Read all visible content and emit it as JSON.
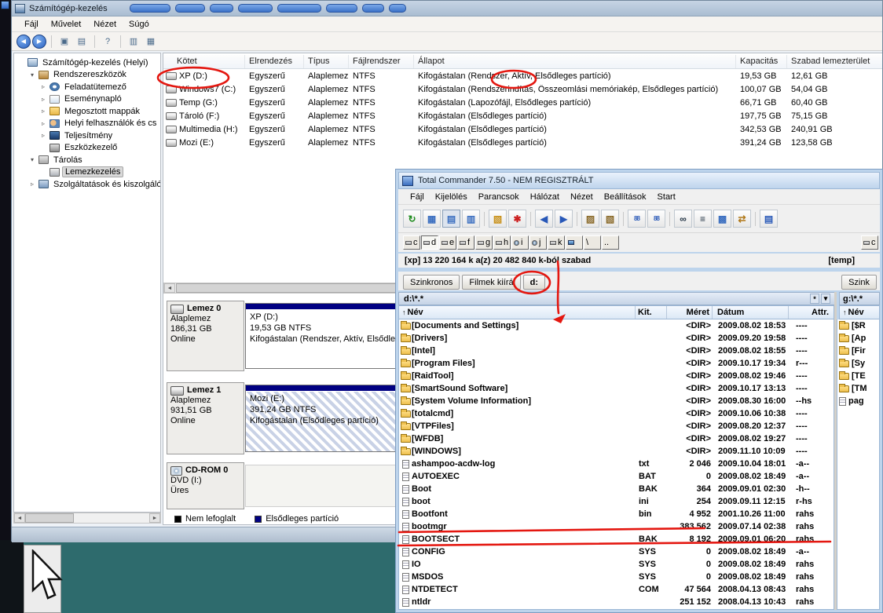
{
  "annotations": {
    "color": "#e41710"
  },
  "cm": {
    "title": "Számítógép-kezelés",
    "menu": [
      "Fájl",
      "Művelet",
      "Nézet",
      "Súgó"
    ],
    "toolbar": [
      {
        "name": "back-icon",
        "glyph": "◀",
        "circle": true
      },
      {
        "name": "forward-icon",
        "glyph": "▶",
        "circle": true
      },
      {
        "name": "sep"
      },
      {
        "name": "window-icon",
        "glyph": "▣"
      },
      {
        "name": "document-icon",
        "glyph": "▤"
      },
      {
        "name": "sep"
      },
      {
        "name": "help-icon",
        "glyph": "?"
      },
      {
        "name": "sep"
      },
      {
        "name": "console-tree-icon",
        "glyph": "▥"
      },
      {
        "name": "panes-icon",
        "glyph": "▦"
      }
    ],
    "tree": {
      "items": [
        {
          "label": "Számítógép-kezelés (Helyi)",
          "level": 0,
          "icon": "computer-icon",
          "exp": ""
        },
        {
          "label": "Rendszereszközök",
          "level": 1,
          "icon": "system-tools-icon",
          "exp": "down"
        },
        {
          "label": "Feladatütemező",
          "level": 2,
          "icon": "task-scheduler-icon",
          "exp": "right"
        },
        {
          "label": "Eseménynapló",
          "level": 2,
          "icon": "event-viewer-icon",
          "exp": "right"
        },
        {
          "label": "Megosztott mappák",
          "level": 2,
          "icon": "shared-folders-icon",
          "exp": "right"
        },
        {
          "label": "Helyi felhasználók és cs",
          "level": 2,
          "icon": "local-users-icon",
          "exp": "right"
        },
        {
          "label": "Teljesítmény",
          "level": 2,
          "icon": "performance-icon",
          "exp": "right"
        },
        {
          "label": "Eszközkezelő",
          "level": 2,
          "icon": "device-manager-icon",
          "exp": ""
        },
        {
          "label": "Tárolás",
          "level": 1,
          "icon": "storage-icon",
          "exp": "down"
        },
        {
          "label": "Lemezkezelés",
          "level": 2,
          "icon": "disk-management-icon",
          "exp": "",
          "selected": true
        },
        {
          "label": "Szolgáltatások és kiszolgáló",
          "level": 1,
          "icon": "services-icon",
          "exp": "right"
        }
      ]
    },
    "volumes": {
      "columns": [
        "Kötet",
        "Elrendezés",
        "Típus",
        "Fájlrendszer",
        "Állapot",
        "Kapacitás",
        "Szabad lemezterület"
      ],
      "rows": [
        {
          "name": "XP (D:)",
          "layout": "Egyszerű",
          "type": "Alaplemez",
          "fs": "NTFS",
          "status": "Kifogástalan (Rendszer, Aktív, Elsődleges partíció)",
          "capacity": "19,53 GB",
          "free": "12,61 GB"
        },
        {
          "name": "Windows7 (C:)",
          "layout": "Egyszerű",
          "type": "Alaplemez",
          "fs": "NTFS",
          "status": "Kifogástalan (Rendszerindítás, Összeomlási memóriakép, Elsődleges partíció)",
          "capacity": "100,07 GB",
          "free": "54,04 GB"
        },
        {
          "name": "Temp (G:)",
          "layout": "Egyszerű",
          "type": "Alaplemez",
          "fs": "NTFS",
          "status": "Kifogástalan (Lapozófájl, Elsődleges partíció)",
          "capacity": "66,71 GB",
          "free": "60,40 GB"
        },
        {
          "name": "Tároló (F:)",
          "layout": "Egyszerű",
          "type": "Alaplemez",
          "fs": "NTFS",
          "status": "Kifogástalan (Elsődleges partíció)",
          "capacity": "197,75 GB",
          "free": "75,15 GB"
        },
        {
          "name": "Multimedia (H:)",
          "layout": "Egyszerű",
          "type": "Alaplemez",
          "fs": "NTFS",
          "status": "Kifogástalan (Elsődleges partíció)",
          "capacity": "342,53 GB",
          "free": "240,91 GB"
        },
        {
          "name": "Mozi (E:)",
          "layout": "Egyszerű",
          "type": "Alaplemez",
          "fs": "NTFS",
          "status": "Kifogástalan (Elsődleges partíció)",
          "capacity": "391,24 GB",
          "free": "123,58 GB"
        }
      ]
    },
    "disks": [
      {
        "name": "Lemez 0",
        "kind": "Alaplemez",
        "size": "186,31 GB",
        "status": "Online",
        "icon": "disk-icon",
        "partition": {
          "label": "XP (D:)",
          "size": "19,53 GB NTFS",
          "status": "Kifogástalan (Rendszer, Aktív, Elsődleges partíció)",
          "hatched": false
        }
      },
      {
        "name": "Lemez 1",
        "kind": "Alaplemez",
        "size": "931,51 GB",
        "status": "Online",
        "icon": "disk-icon",
        "partition": {
          "label": "Mozi (E:)",
          "size": "391,24 GB NTFS",
          "status": "Kifogástalan (Elsődleges partíció)",
          "hatched": true
        }
      },
      {
        "name": "CD-ROM 0",
        "kind": "DVD (I:)",
        "size": "",
        "status": "Üres",
        "icon": "cd-icon",
        "partition": null
      }
    ],
    "legend": [
      {
        "color": "#000000",
        "label": "Nem lefoglalt"
      },
      {
        "color": "#000082",
        "label": "Elsődleges partíció"
      }
    ]
  },
  "tc": {
    "title": "Total Commander 7.50 - NEM REGISZTRÁLT",
    "menu": [
      "Fájl",
      "Kijelölés",
      "Parancsok",
      "Hálózat",
      "Nézet",
      "Beállítások",
      "Start"
    ],
    "toolbar": [
      {
        "name": "refresh-icon",
        "glyph": "↻",
        "color": "#1a8a1a"
      },
      {
        "name": "view-thumbnails-icon",
        "glyph": "▦",
        "color": "#3a6ec0"
      },
      {
        "name": "view-brief-icon",
        "glyph": "▤",
        "color": "#3a6ec0",
        "pressed": true
      },
      {
        "name": "view-full-icon",
        "glyph": "▥",
        "color": "#3a6ec0"
      },
      {
        "name": "sep"
      },
      {
        "name": "folder-view-icon",
        "glyph": "▧",
        "color": "#c89018"
      },
      {
        "name": "show-all-files-icon",
        "glyph": "✱",
        "color": "#cc2020"
      },
      {
        "name": "sep"
      },
      {
        "name": "back-icon",
        "glyph": "◀",
        "color": "#2858b8"
      },
      {
        "name": "forward-icon",
        "glyph": "▶",
        "color": "#2858b8"
      },
      {
        "name": "sep"
      },
      {
        "name": "pack-icon",
        "glyph": "▨",
        "color": "#8a6a2a"
      },
      {
        "name": "unpack-icon",
        "glyph": "▧",
        "color": "#8a6a2a"
      },
      {
        "name": "sep"
      },
      {
        "name": "ftp-connect-icon",
        "glyph": "88",
        "color": "#2858b8",
        "small": true
      },
      {
        "name": "ftp-new-connection-icon",
        "glyph": "88",
        "color": "#2858b8",
        "small": true
      },
      {
        "name": "sep"
      },
      {
        "name": "search-icon",
        "glyph": "∞",
        "color": "#223344"
      },
      {
        "name": "dir-tree-icon",
        "glyph": "≡",
        "color": "#223344"
      },
      {
        "name": "multi-rename-icon",
        "glyph": "▩",
        "color": "#3a6ec0"
      },
      {
        "name": "sync-dirs-icon",
        "glyph": "⇄",
        "color": "#b07818"
      },
      {
        "name": "sep"
      },
      {
        "name": "notepad-icon",
        "glyph": "▤",
        "color": "#2858b8"
      }
    ],
    "drives": [
      {
        "l": "c",
        "kind": "hdd"
      },
      {
        "l": "d",
        "kind": "hdd",
        "active": true
      },
      {
        "l": "e",
        "kind": "hdd"
      },
      {
        "l": "f",
        "kind": "hdd"
      },
      {
        "l": "g",
        "kind": "hdd"
      },
      {
        "l": "h",
        "kind": "hdd"
      },
      {
        "l": "i",
        "kind": "cd"
      },
      {
        "l": "j",
        "kind": "cd"
      },
      {
        "l": "k",
        "kind": "hdd"
      },
      {
        "l": "",
        "kind": "net"
      },
      {
        "l": "\\",
        "kind": "root"
      },
      {
        "l": "..",
        "kind": "up"
      }
    ],
    "right_drive": {
      "l": "c",
      "kind": "hdd"
    },
    "drive_info": "[xp] 13 220 164 k a(z) 20 482 840 k-ból szabad",
    "right_label": "[temp]",
    "buttons": [
      "Szinkronos",
      "Filmek kiírá"
    ],
    "dir_tab": "d:",
    "right_tab": "Szink",
    "path": "d:\\*.*",
    "path_star": "*",
    "path_history": "▾",
    "right_path": "g:\\*.*",
    "columns": [
      "Név",
      "Kit.",
      "Méret",
      "Dátum",
      "Attr."
    ],
    "sort_arrow": "↑",
    "right_header": "Név",
    "files": [
      {
        "name": "[Documents and Settings]",
        "ext": "",
        "size": "<DIR>",
        "date": "2009.08.02 18:53",
        "attr": "----",
        "kind": "dir"
      },
      {
        "name": "[Drivers]",
        "ext": "",
        "size": "<DIR>",
        "date": "2009.09.20 19:58",
        "attr": "----",
        "kind": "dir"
      },
      {
        "name": "[Intel]",
        "ext": "",
        "size": "<DIR>",
        "date": "2009.08.02 18:55",
        "attr": "----",
        "kind": "dir"
      },
      {
        "name": "[Program Files]",
        "ext": "",
        "size": "<DIR>",
        "date": "2009.10.17 19:34",
        "attr": "r---",
        "kind": "dir"
      },
      {
        "name": "[RaidTool]",
        "ext": "",
        "size": "<DIR>",
        "date": "2009.08.02 19:46",
        "attr": "----",
        "kind": "dir"
      },
      {
        "name": "[SmartSound Software]",
        "ext": "",
        "size": "<DIR>",
        "date": "2009.10.17 13:13",
        "attr": "----",
        "kind": "dir"
      },
      {
        "name": "[System Volume Information]",
        "ext": "",
        "size": "<DIR>",
        "date": "2009.08.30 16:00",
        "attr": "--hs",
        "kind": "dir"
      },
      {
        "name": "[totalcmd]",
        "ext": "",
        "size": "<DIR>",
        "date": "2009.10.06 10:38",
        "attr": "----",
        "kind": "dir"
      },
      {
        "name": "[VTPFiles]",
        "ext": "",
        "size": "<DIR>",
        "date": "2009.08.20 12:37",
        "attr": "----",
        "kind": "dir"
      },
      {
        "name": "[WFDB]",
        "ext": "",
        "size": "<DIR>",
        "date": "2009.08.02 19:27",
        "attr": "----",
        "kind": "dir"
      },
      {
        "name": "[WINDOWS]",
        "ext": "",
        "size": "<DIR>",
        "date": "2009.11.10 10:09",
        "attr": "----",
        "kind": "dir"
      },
      {
        "name": "ashampoo-acdw-log",
        "ext": "txt",
        "size": "2 046",
        "date": "2009.10.04 18:01",
        "attr": "-a--",
        "kind": "file"
      },
      {
        "name": "AUTOEXEC",
        "ext": "BAT",
        "size": "0",
        "date": "2009.08.02 18:49",
        "attr": "-a--",
        "kind": "file"
      },
      {
        "name": "Boot",
        "ext": "BAK",
        "size": "364",
        "date": "2009.09.01 02:30",
        "attr": "-h--",
        "kind": "file"
      },
      {
        "name": "boot",
        "ext": "ini",
        "size": "254",
        "date": "2009.09.11 12:15",
        "attr": "r-hs",
        "kind": "file"
      },
      {
        "name": "Bootfont",
        "ext": "bin",
        "size": "4 952",
        "date": "2001.10.26 11:00",
        "attr": "rahs",
        "kind": "file"
      },
      {
        "name": "bootmgr",
        "ext": "",
        "size": "383 562",
        "date": "2009.07.14 02:38",
        "attr": "rahs",
        "kind": "file"
      },
      {
        "name": "BOOTSECT",
        "ext": "BAK",
        "size": "8 192",
        "date": "2009.09.01 06:20",
        "attr": "rahs",
        "kind": "file"
      },
      {
        "name": "CONFIG",
        "ext": "SYS",
        "size": "0",
        "date": "2009.08.02 18:49",
        "attr": "-a--",
        "kind": "file"
      },
      {
        "name": "IO",
        "ext": "SYS",
        "size": "0",
        "date": "2009.08.02 18:49",
        "attr": "rahs",
        "kind": "file"
      },
      {
        "name": "MSDOS",
        "ext": "SYS",
        "size": "0",
        "date": "2009.08.02 18:49",
        "attr": "rahs",
        "kind": "file"
      },
      {
        "name": "NTDETECT",
        "ext": "COM",
        "size": "47 564",
        "date": "2008.04.13 08:43",
        "attr": "rahs",
        "kind": "file"
      },
      {
        "name": "ntldr",
        "ext": "",
        "size": "251 152",
        "date": "2008.04.13 10:43",
        "attr": "rahs",
        "kind": "file"
      }
    ],
    "right_files": [
      {
        "name": "[$R",
        "kind": "dir"
      },
      {
        "name": "[Ap",
        "kind": "dir"
      },
      {
        "name": "[Fir",
        "kind": "dir"
      },
      {
        "name": "[Sy",
        "kind": "dir"
      },
      {
        "name": "[TE",
        "kind": "dir"
      },
      {
        "name": "[TM",
        "kind": "dir"
      },
      {
        "name": "pag",
        "kind": "file"
      }
    ]
  }
}
